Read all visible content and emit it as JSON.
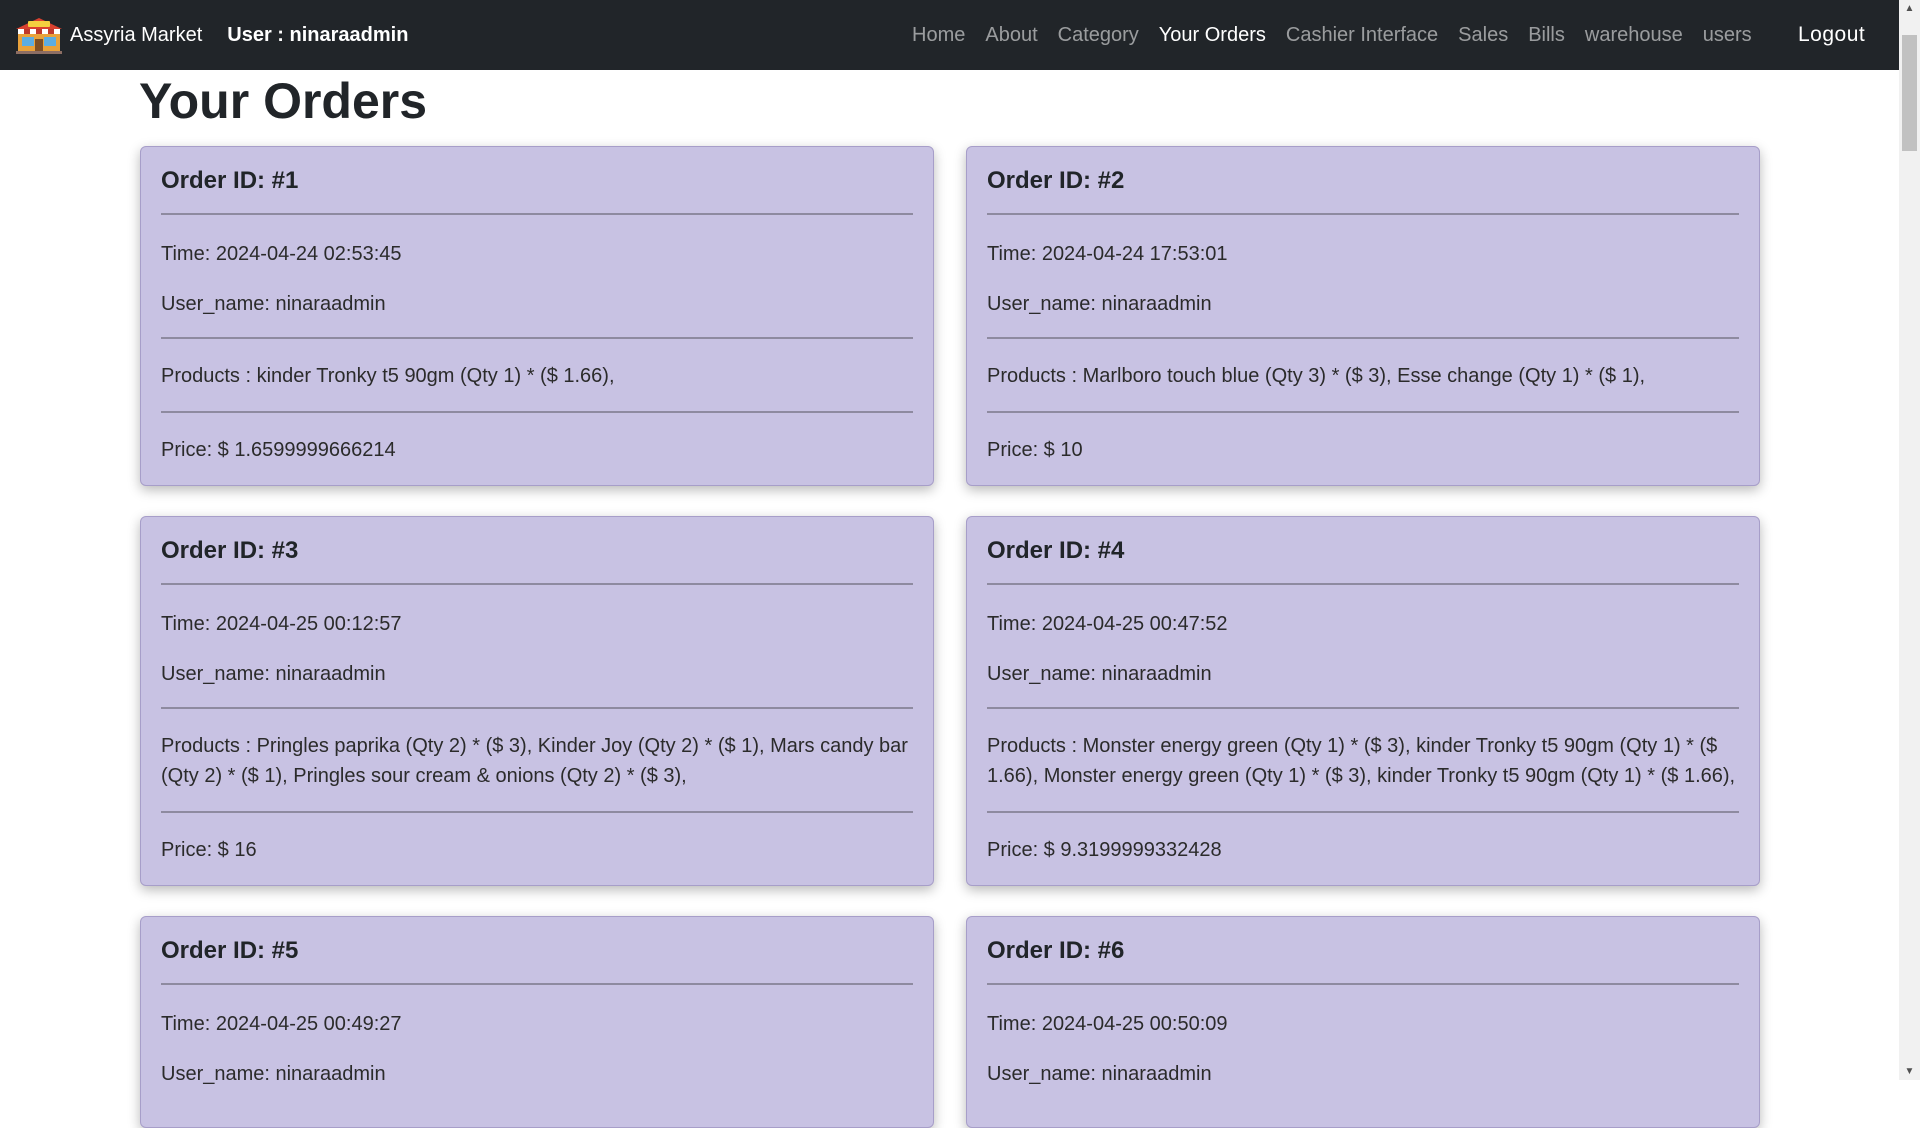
{
  "nav": {
    "brand": "Assyria Market",
    "user_label": "User : ninaraadmin",
    "links": [
      "Home",
      "About",
      "Category",
      "Your Orders",
      "Cashier Interface",
      "Sales",
      "Bills",
      "warehouse",
      "users"
    ],
    "active": "Your Orders",
    "logout": "Logout"
  },
  "page": {
    "title": "Your Orders"
  },
  "orders": [
    {
      "title": "Order ID: #1",
      "time": "Time: 2024-04-24 02:53:45",
      "user": "User_name: ninaraadmin",
      "products": "Products : kinder Tronky t5 90gm (Qty 1) * ($ 1.66),",
      "price": "Price: $ 1.6599999666214"
    },
    {
      "title": "Order ID: #2",
      "time": "Time: 2024-04-24 17:53:01",
      "user": "User_name: ninaraadmin",
      "products": "Products : Marlboro touch blue (Qty 3) * ($ 3), Esse change (Qty 1) * ($ 1),",
      "price": "Price: $ 10"
    },
    {
      "title": "Order ID: #3",
      "time": "Time: 2024-04-25 00:12:57",
      "user": "User_name: ninaraadmin",
      "products": "Products : Pringles paprika (Qty 2) * ($ 3), Kinder Joy (Qty 2) * ($ 1), Mars candy bar (Qty 2) * ($ 1), Pringles sour cream & onions (Qty 2) * ($ 3),",
      "price": "Price: $ 16"
    },
    {
      "title": "Order ID: #4",
      "time": "Time: 2024-04-25 00:47:52",
      "user": "User_name: ninaraadmin",
      "products": "Products : Monster energy green (Qty 1) * ($ 3), kinder Tronky t5 90gm (Qty 1) * ($ 1.66), Monster energy green (Qty 1) * ($ 3), kinder Tronky t5 90gm (Qty 1) * ($ 1.66),",
      "price": "Price: $ 9.3199999332428"
    },
    {
      "title": "Order ID: #5",
      "time": "Time: 2024-04-25 00:49:27",
      "user": "User_name: ninaraadmin"
    },
    {
      "title": "Order ID: #6",
      "time": "Time: 2024-04-25 00:50:09",
      "user": "User_name: ninaraadmin"
    }
  ]
}
